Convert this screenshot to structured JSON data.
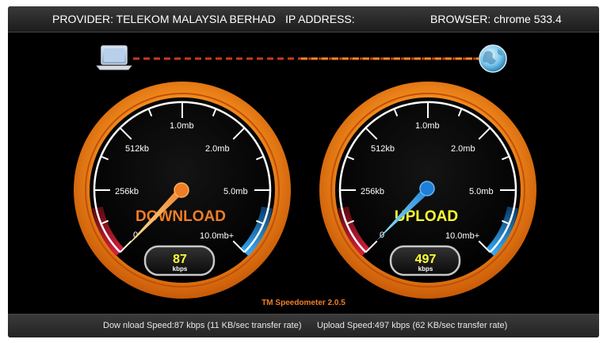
{
  "header": {
    "provider": "PROVIDER: TELEKOM MALAYSIA BERHAD",
    "ip_address": "IP ADDRESS:",
    "browser": "BROWSER: chrome 533.4"
  },
  "gauge_labels": {
    "l256": "256kb",
    "l512": "512kb",
    "l1m": "1.0mb",
    "l2m": "2.0mb",
    "l5m": "5.0mb",
    "l10m": "10.0mb+",
    "zero": "0"
  },
  "download": {
    "title": "DOWNLOAD",
    "value": "87",
    "unit": "kbps"
  },
  "upload": {
    "title": "UPLOAD",
    "value": "497",
    "unit": "kbps"
  },
  "version": "TM Speedometer 2.0.5",
  "footer": {
    "download_speed": "Dow nload Speed:87 kbps (11 KB/sec transfer rate)",
    "upload_speed": "Upload Speed:497 kbps (62 KB/sec transfer rate)"
  },
  "colors": {
    "download_accent": "#f07e26",
    "upload_accent": "#1e7fd8",
    "value_yellow": "#ffff33",
    "version_orange": "#f07e26"
  },
  "icons": {
    "client": "laptop-icon",
    "server": "globe-icon"
  }
}
